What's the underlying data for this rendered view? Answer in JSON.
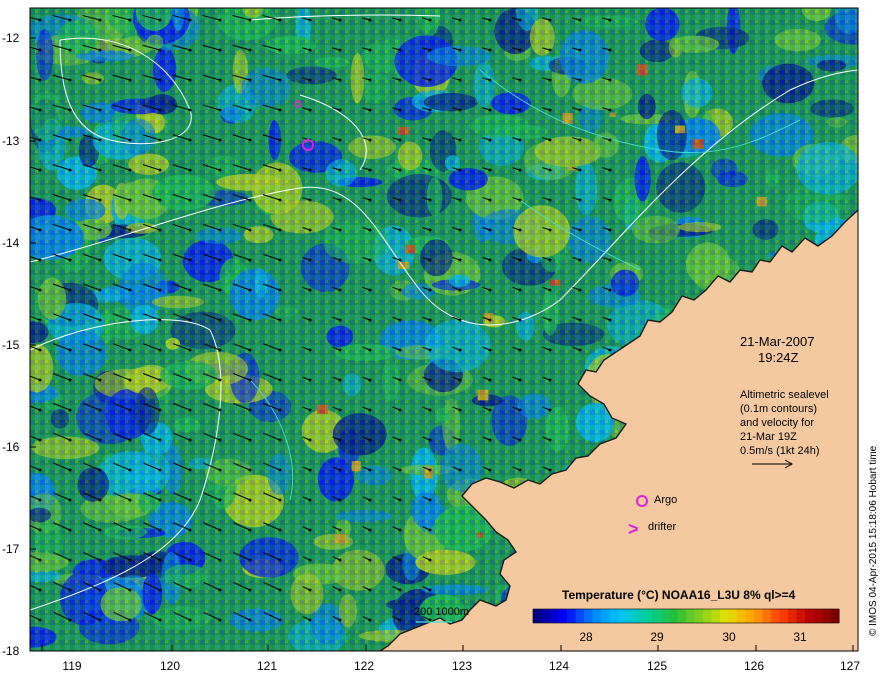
{
  "map": {
    "date": "21-Mar-2007",
    "time": "19:24Z",
    "altimetry_note": [
      "Altimetric sealevel",
      "(0.1m contours)",
      "and velocity for",
      "21-Mar 19Z",
      "0.5m/s (1kt 24h)"
    ],
    "argo_label": "Argo",
    "drifter_label": "drifter",
    "drifter_symbol": ">",
    "depth_label": "200  1000m",
    "credit": "© IMOS 04-Apr-2015 15:18:06 Hobart time",
    "lat_ticks": [
      "-12",
      "-13",
      "-14",
      "-15",
      "-16",
      "-17",
      "-18"
    ],
    "lon_ticks": [
      "119",
      "120",
      "121",
      "122",
      "123",
      "124",
      "125",
      "126",
      "127"
    ],
    "colors": {
      "land": "#f5c9a0",
      "coast": "#1a1a1a",
      "argo": "#e020e0",
      "drifter": "#e020e0",
      "contour": "#ffffff",
      "depth_200": "#40e0d0",
      "vector": "#000000"
    }
  },
  "colorbar": {
    "title": "Temperature (°C) NOAA16_L3U 8% ql>=4",
    "ticks": [
      "28",
      "29",
      "30",
      "31"
    ],
    "stops": [
      "#000080",
      "#0000ff",
      "#0080ff",
      "#00c0ff",
      "#00d0a0",
      "#20c040",
      "#80d020",
      "#e0e000",
      "#ffa000",
      "#ff4000",
      "#c00000",
      "#800000"
    ]
  }
}
